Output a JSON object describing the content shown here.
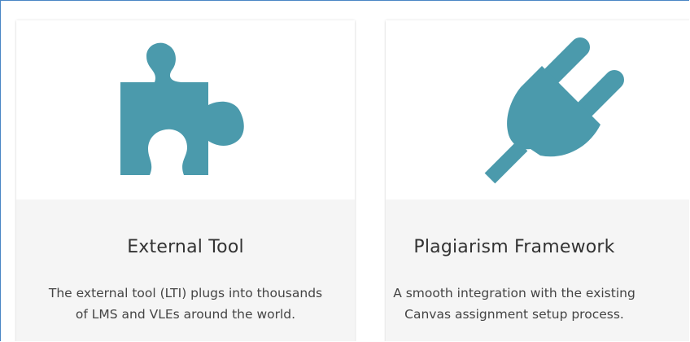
{
  "cards": [
    {
      "icon": "puzzle-piece-icon",
      "title": "External Tool",
      "description_lines": [
        "The external tool (LTI) plugs into thousands",
        "of LMS and VLEs around the world."
      ]
    },
    {
      "icon": "plug-icon",
      "title": "Plagiarism Framework",
      "description_lines": [
        "A smooth integration with the existing",
        "Canvas assignment setup process."
      ]
    }
  ],
  "colors": {
    "icon": "#4b9aac",
    "frame_border": "#4a86c5",
    "card_bottom": "#f5f5f5",
    "title_text": "#333333"
  }
}
